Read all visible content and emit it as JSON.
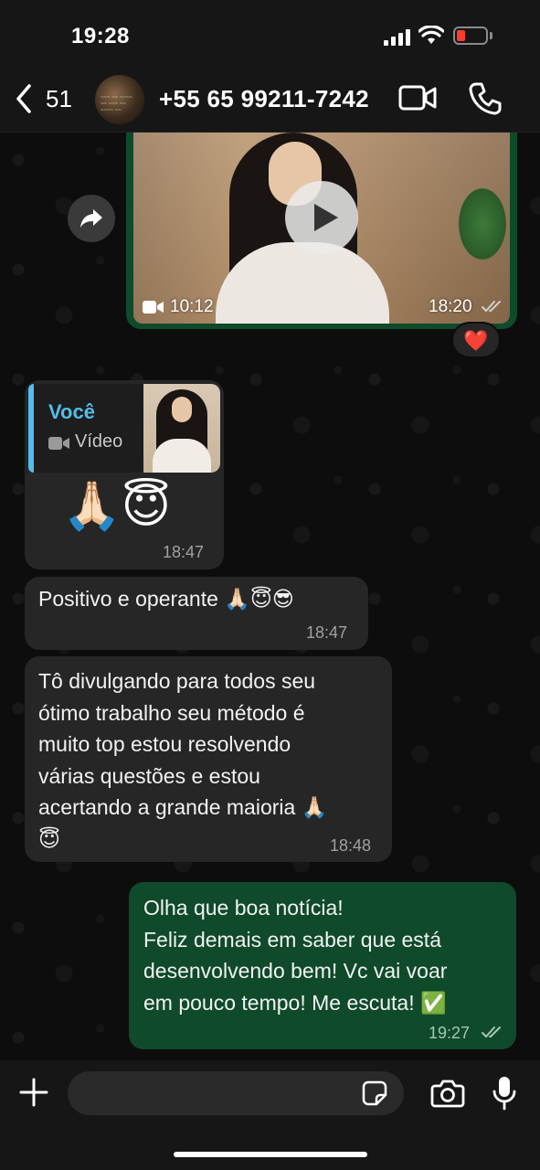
{
  "status_bar": {
    "time": "19:28"
  },
  "header": {
    "back_count": "51",
    "contact": "+55 65 99211-7242"
  },
  "messages": {
    "video": {
      "duration": "10:12",
      "time": "18:20",
      "reaction": "❤️"
    },
    "reply": {
      "quoted_author": "Você",
      "quoted_type": "Vídeo",
      "emojis": "🙏🏻😇",
      "time": "18:47"
    },
    "m2": {
      "text": "Positivo e operante 🙏🏻😇😎",
      "time": "18:47"
    },
    "m3": {
      "text": "Tô divulgando para todos seu\nótimo trabalho seu método é\nmuito top estou resolvendo\nvárias questões e estou\nacertando a grande maioria 🙏🏻\n😇",
      "time": "18:48"
    },
    "m4": {
      "text": "Olha que boa notícia!\nFeliz demais em saber que está\ndesenvolvendo bem! Vc vai voar\nem pouco tempo! Me escuta! ✅",
      "time": "19:27"
    }
  },
  "input": {
    "placeholder": ""
  },
  "colors": {
    "outgoing": "#0f4a2a",
    "incoming": "#262626",
    "quote_accent": "#53bdeb",
    "battery_low": "#ff3b30"
  },
  "icons": [
    "back-chevron-icon",
    "video-call-icon",
    "phone-icon",
    "forward-icon",
    "play-icon",
    "video-camera-icon",
    "double-check-icon",
    "plus-icon",
    "sticker-icon",
    "camera-icon",
    "microphone-icon"
  ]
}
